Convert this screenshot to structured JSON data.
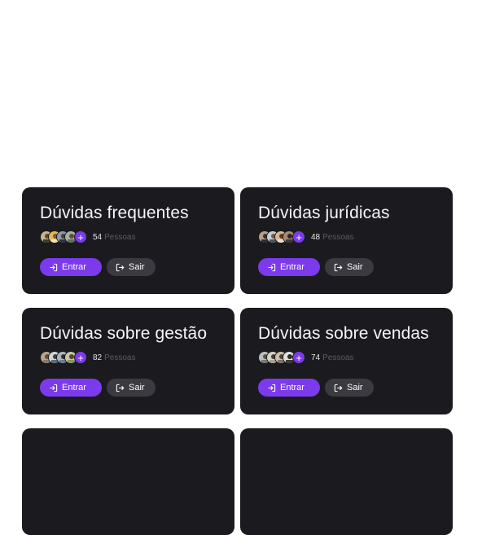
{
  "cards": [
    {
      "title": "Dúvidas frequentes",
      "count": "54",
      "people_label": "Pessoas",
      "enter_label": "Entrar",
      "exit_label": "Sair"
    },
    {
      "title": "Dúvidas jurídicas",
      "count": "48",
      "people_label": "Pessoas",
      "enter_label": "Entrar",
      "exit_label": "Sair"
    },
    {
      "title": "Dúvidas sobre gestão",
      "count": "82",
      "people_label": "Pessoas",
      "enter_label": "Entrar",
      "exit_label": "Sair"
    },
    {
      "title": "Dúvidas sobre vendas",
      "count": "74",
      "people_label": "Pessoas",
      "enter_label": "Entrar",
      "exit_label": "Sair"
    },
    {
      "title": "",
      "count": "",
      "people_label": "",
      "enter_label": "",
      "exit_label": ""
    },
    {
      "title": "",
      "count": "",
      "people_label": "",
      "enter_label": "",
      "exit_label": ""
    }
  ],
  "plus_symbol": "+",
  "colors": {
    "card_bg": "#1b1b1f",
    "accent": "#7c3aed",
    "exit_bg": "#3a3a40"
  }
}
